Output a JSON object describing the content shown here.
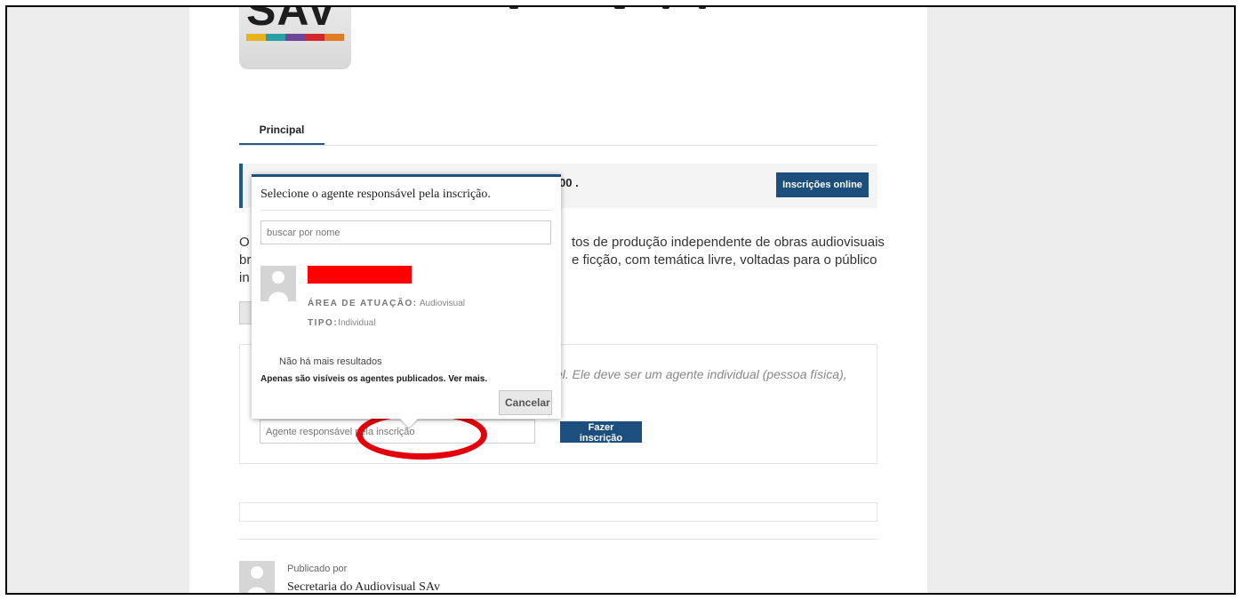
{
  "logo": {
    "text": "SAV",
    "stripe_colors": [
      "#e8b21c",
      "#2aa0a5",
      "#6b4696",
      "#d1282e",
      "#e07a25"
    ]
  },
  "tabs": {
    "principal": "Principal"
  },
  "info_bar": {
    "text_fragment": "00 .",
    "button": "Inscrições online"
  },
  "description": {
    "line1_left": "O",
    "line1_right": "tos de produção independente de obras audiovisuais",
    "line2_left": "br",
    "line2_right": "e ficção, com temática livre, voltadas para o público",
    "line3_left": "in"
  },
  "registration": {
    "instructions_fragment": "el. Ele deve ser um agente individual (pessoa física),",
    "agent_placeholder": "Agente responsável pela inscrição",
    "submit_button": "Fazer inscrição"
  },
  "publisher": {
    "label": "Publicado por",
    "name": "Secretaria do Audiovisual SAv"
  },
  "popup": {
    "title": "Selecione o agente responsável pela inscrição.",
    "search_placeholder": "buscar por nome",
    "result": {
      "area_label": "ÁREA DE ATUAÇÃO:",
      "area_value": "Audiovisual",
      "type_label": "TIPO:",
      "type_value": "Individual"
    },
    "no_more_results": "Não há mais resultados",
    "visibility_note": "Apenas são visíveis os agentes publicados.",
    "see_more": "Ver mais.",
    "cancel": "Cancelar"
  },
  "colors": {
    "accent": "#1c4f7e",
    "highlight_ellipse": "#e3000b",
    "redaction": "#ff0000"
  }
}
